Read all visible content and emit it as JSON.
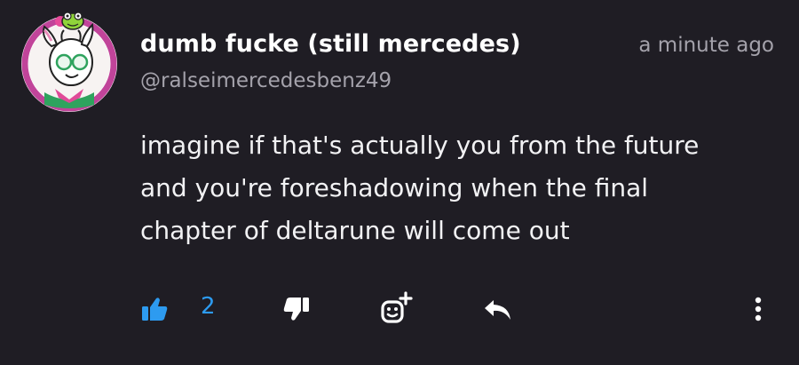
{
  "comment": {
    "author_name": "dumb fucke (still mercedes)",
    "author_handle": "@ralseimercedesbenz49",
    "timestamp": "a minute ago",
    "body_lines": [
      "imagine if that's actually you from the future",
      "and you're foreshadowing when the final",
      "chapter of deltarune will come out"
    ]
  },
  "actions": {
    "like_count": "2",
    "like_state": "liked",
    "like_icon": "thumbs-up-icon",
    "dislike_icon": "thumbs-down-icon",
    "react_icon": "add-reaction-icon",
    "reply_icon": "reply-icon",
    "more_icon": "more-vertical-icon"
  },
  "colors": {
    "background": "#1f1d24",
    "accent": "#2d9bf0",
    "text_primary": "#ffffff",
    "text_secondary": "#a4a2ab",
    "avatar_ring": "#c1449a"
  }
}
